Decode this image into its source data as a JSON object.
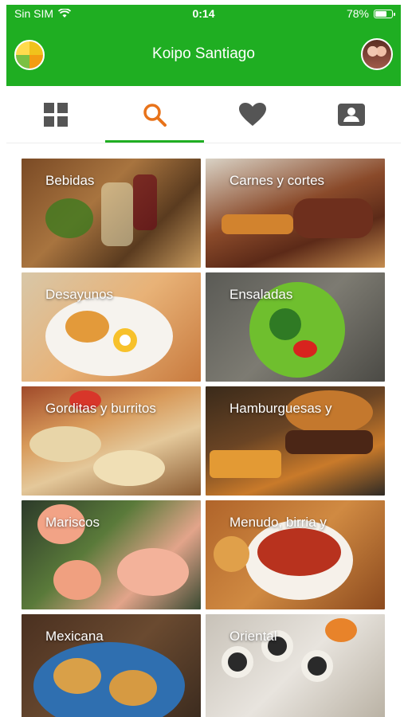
{
  "status_bar": {
    "carrier": "Sin SIM",
    "time": "0:14",
    "battery": "78%",
    "battery_level": 0.78
  },
  "header": {
    "title": "Koipo Santiago"
  },
  "tabs": [
    {
      "name": "grid-icon",
      "active": false
    },
    {
      "name": "search-icon",
      "active": true,
      "color": "#e8731a"
    },
    {
      "name": "heart-icon",
      "active": false
    },
    {
      "name": "contact-card-icon",
      "active": false
    }
  ],
  "colors": {
    "brand": "#1fae22",
    "accent": "#e8731a",
    "icon_gray": "#555555"
  },
  "categories": [
    {
      "label": "Bebidas"
    },
    {
      "label": "Carnes y cortes"
    },
    {
      "label": "Desayunos"
    },
    {
      "label": "Ensaladas"
    },
    {
      "label": "Gorditas y burritos"
    },
    {
      "label": "Hamburguesas y"
    },
    {
      "label": "Mariscos"
    },
    {
      "label": "Menudo, birria y"
    },
    {
      "label": "Mexicana"
    },
    {
      "label": "Oriental"
    }
  ]
}
